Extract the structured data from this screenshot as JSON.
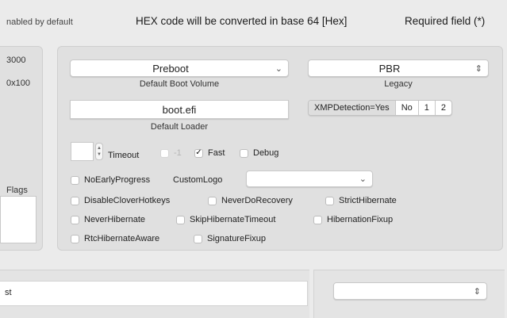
{
  "header": {
    "left_note": "nabled by default",
    "hex_note": "HEX code will be converted in base 64 [Hex]",
    "required_note": "Required field (*)"
  },
  "left_panel": {
    "value1": "3000",
    "value2": "0x100",
    "flags_label": "Flags"
  },
  "boot": {
    "default_volume": {
      "value": "Preboot",
      "caption": "Default Boot Volume"
    },
    "legacy": {
      "value": "PBR",
      "caption": "Legacy"
    },
    "default_loader": {
      "value": "boot.efi",
      "caption": "Default Loader"
    },
    "xmp": {
      "options": [
        "XMPDetection=Yes",
        "No",
        "1",
        "2"
      ],
      "selected": "XMPDetection=Yes"
    },
    "timeout": {
      "label": "Timeout",
      "value": ""
    },
    "minus_one": {
      "label": "-1",
      "checked": false,
      "enabled": false
    },
    "fast": {
      "label": "Fast",
      "checked": true
    },
    "debug": {
      "label": "Debug",
      "checked": false
    },
    "no_early_progress": {
      "label": "NoEarlyProgress",
      "checked": false
    },
    "custom_logo": {
      "label": "CustomLogo",
      "value": ""
    },
    "checkboxes_row1": [
      {
        "label": "DisableCloverHotkeys",
        "checked": false
      },
      {
        "label": "NeverDoRecovery",
        "checked": false
      },
      {
        "label": "StrictHibernate",
        "checked": false
      }
    ],
    "checkboxes_row2": [
      {
        "label": "NeverHibernate",
        "checked": false
      },
      {
        "label": "SkipHibernateTimeout",
        "checked": false
      },
      {
        "label": "HibernationFixup",
        "checked": false
      }
    ],
    "checkboxes_row3": [
      {
        "label": "RtcHibernateAware",
        "checked": false
      },
      {
        "label": "SignatureFixup",
        "checked": false
      }
    ]
  },
  "bottom": {
    "list_first_item": "st",
    "right_select_value": ""
  },
  "icons": {
    "chevron_down": "⌄",
    "updown": "⇕",
    "check": "✓"
  }
}
